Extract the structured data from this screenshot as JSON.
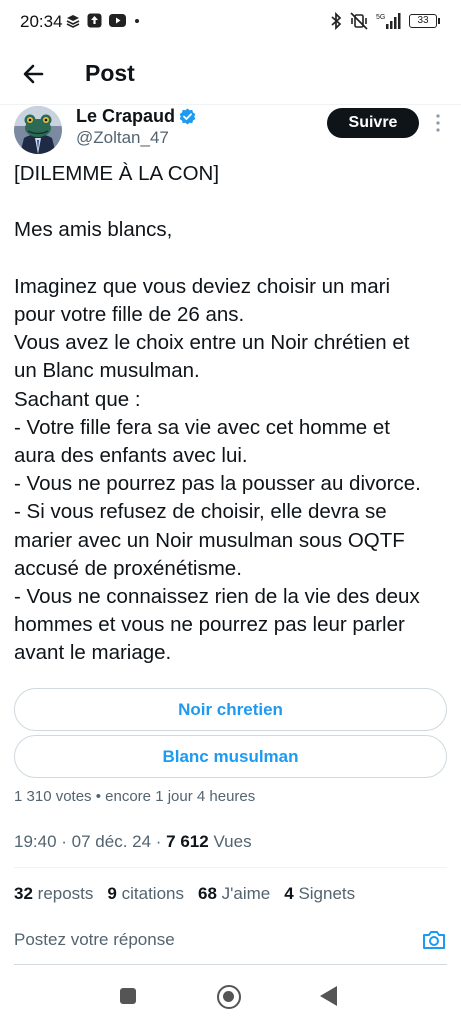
{
  "status_bar": {
    "time": "20:34",
    "network": "5G",
    "battery": "33",
    "left_icons": [
      "layers-icon",
      "upload-icon",
      "youtube-icon",
      "dot-icon"
    ],
    "right_icons": [
      "bluetooth-icon",
      "muted-vibrate-icon",
      "signal-icon",
      "battery-icon"
    ]
  },
  "header": {
    "title": "Post"
  },
  "author": {
    "display_name": "Le Crapaud",
    "handle": "@Zoltan_47",
    "verified": true,
    "follow_label": "Suivre"
  },
  "tweet": {
    "paragraphs": [
      [
        "[DILEMME À LA CON]"
      ],
      [
        "Mes amis blancs,"
      ],
      [
        "Imaginez que vous deviez choisir un mari",
        "pour votre fille de 26 ans.",
        "Vous avez le choix entre un Noir chrétien et",
        "un Blanc musulman.",
        "Sachant que :",
        "- Votre fille fera sa vie avec cet homme et",
        "aura des enfants avec lui.",
        "- Vous ne pourrez pas la pousser au divorce.",
        "- Si vous refusez de choisir, elle devra se",
        "marier avec un Noir musulman sous OQTF",
        "accusé de proxénétisme.",
        "- Vous ne connaissez rien de la vie des deux",
        "hommes et vous ne pourrez pas leur parler",
        "avant le mariage."
      ]
    ]
  },
  "poll": {
    "options": [
      "Noir chretien",
      "Blanc musulman"
    ],
    "votes": "1 310 votes",
    "separator": " • ",
    "remaining": "encore 1 jour 4 heures"
  },
  "meta": {
    "time": "19:40",
    "date": "07 déc. 24",
    "views_count": "7 612",
    "views_label": "Vues"
  },
  "stats": {
    "reposts_count": "32",
    "reposts_label": "reposts",
    "quotes_count": "9",
    "quotes_label": "citations",
    "likes_count": "68",
    "likes_label": "J'aime",
    "bookmarks_count": "4",
    "bookmarks_label": "Signets"
  },
  "reply": {
    "placeholder": "Postez votre réponse"
  },
  "colors": {
    "accent": "#1d9bf0",
    "text": "#0f1419",
    "secondary": "#536471",
    "border": "#cfd9de"
  }
}
